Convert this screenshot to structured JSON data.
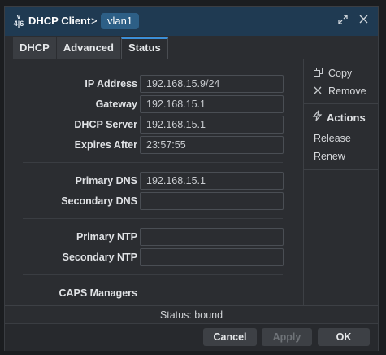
{
  "titlebar": {
    "app_icon": "v\n4|6",
    "title": "DHCP Client",
    "separator": ">",
    "breadcrumb": "vlan1",
    "restore_icon": "restore-icon",
    "close_icon": "close-icon"
  },
  "tabs": [
    {
      "label": "DHCP"
    },
    {
      "label": "Advanced"
    },
    {
      "label": "Status",
      "active": true
    }
  ],
  "fields": {
    "ip_address": {
      "label": "IP Address",
      "value": "192.168.15.9/24"
    },
    "gateway": {
      "label": "Gateway",
      "value": "192.168.15.1"
    },
    "dhcp_server": {
      "label": "DHCP Server",
      "value": "192.168.15.1"
    },
    "expires_after": {
      "label": "Expires After",
      "value": "23:57:55"
    },
    "primary_dns": {
      "label": "Primary DNS",
      "value": "192.168.15.1"
    },
    "secondary_dns": {
      "label": "Secondary DNS",
      "value": ""
    },
    "primary_ntp": {
      "label": "Primary NTP",
      "value": ""
    },
    "secondary_ntp": {
      "label": "Secondary NTP",
      "value": ""
    },
    "caps_managers": {
      "label": "CAPS Managers"
    }
  },
  "sidebar": {
    "copy": "Copy",
    "remove": "Remove",
    "actions_heading": "Actions",
    "release": "Release",
    "renew": "Renew"
  },
  "status": "Status: bound",
  "footer": {
    "cancel": "Cancel",
    "apply": "Apply",
    "ok": "OK"
  },
  "colors": {
    "titlebar": "#1f3a52",
    "accent": "#3b8fd8",
    "breadcrumb_chip": "#2d5f86",
    "panel_bg": "#2b2d31"
  }
}
